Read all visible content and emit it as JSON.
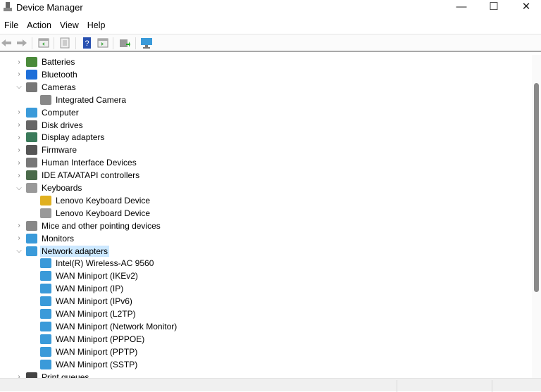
{
  "window": {
    "title": "Device Manager",
    "minimize": "—",
    "maximize": "☐",
    "close": "✕"
  },
  "menu": [
    "File",
    "Action",
    "View",
    "Help"
  ],
  "toolbar": [
    "back-icon",
    "forward-icon",
    "show-hide-console-tree-icon",
    "properties-icon",
    "help-icon",
    "action-pane-icon",
    "update-driver-icon",
    "scan-hardware-icon"
  ],
  "tree": [
    {
      "label": "Batteries",
      "level": 0,
      "state": "collapsed",
      "icon": "battery-icon",
      "color": "#4a8a3a"
    },
    {
      "label": "Bluetooth",
      "level": 0,
      "state": "collapsed",
      "icon": "bluetooth-icon",
      "color": "#1e6fd9"
    },
    {
      "label": "Cameras",
      "level": 0,
      "state": "expanded",
      "icon": "camera-icon",
      "color": "#777777"
    },
    {
      "label": "Integrated Camera",
      "level": 1,
      "icon": "camera-icon",
      "color": "#888888"
    },
    {
      "label": "Computer",
      "level": 0,
      "state": "collapsed",
      "icon": "computer-icon",
      "color": "#3a9ad9"
    },
    {
      "label": "Disk drives",
      "level": 0,
      "state": "collapsed",
      "icon": "disk-drive-icon",
      "color": "#666666"
    },
    {
      "label": "Display adapters",
      "level": 0,
      "state": "collapsed",
      "icon": "display-adapter-icon",
      "color": "#3a7a5a"
    },
    {
      "label": "Firmware",
      "level": 0,
      "state": "collapsed",
      "icon": "firmware-icon",
      "color": "#555555"
    },
    {
      "label": "Human Interface Devices",
      "level": 0,
      "state": "collapsed",
      "icon": "hid-icon",
      "color": "#777777"
    },
    {
      "label": "IDE ATA/ATAPI controllers",
      "level": 0,
      "state": "collapsed",
      "icon": "ide-controller-icon",
      "color": "#4a6a4a"
    },
    {
      "label": "Keyboards",
      "level": 0,
      "state": "expanded",
      "icon": "keyboard-icon",
      "color": "#999999"
    },
    {
      "label": "Lenovo Keyboard Device",
      "level": 1,
      "icon": "keyboard-warning-icon",
      "color": "#e0b020"
    },
    {
      "label": "Lenovo Keyboard Device",
      "level": 1,
      "icon": "keyboard-icon",
      "color": "#999999"
    },
    {
      "label": "Mice and other pointing devices",
      "level": 0,
      "state": "collapsed",
      "icon": "mouse-icon",
      "color": "#888888"
    },
    {
      "label": "Monitors",
      "level": 0,
      "state": "collapsed",
      "icon": "monitor-icon",
      "color": "#3a9ad9"
    },
    {
      "label": "Network adapters",
      "level": 0,
      "state": "expanded",
      "selected": true,
      "icon": "network-adapter-icon",
      "color": "#3a9ad9"
    },
    {
      "label": "Intel(R) Wireless-AC 9560",
      "level": 1,
      "icon": "network-adapter-icon",
      "color": "#3a9ad9"
    },
    {
      "label": "WAN Miniport (IKEv2)",
      "level": 1,
      "icon": "network-adapter-icon",
      "color": "#3a9ad9"
    },
    {
      "label": "WAN Miniport (IP)",
      "level": 1,
      "icon": "network-adapter-icon",
      "color": "#3a9ad9"
    },
    {
      "label": "WAN Miniport (IPv6)",
      "level": 1,
      "icon": "network-adapter-icon",
      "color": "#3a9ad9"
    },
    {
      "label": "WAN Miniport (L2TP)",
      "level": 1,
      "icon": "network-adapter-icon",
      "color": "#3a9ad9"
    },
    {
      "label": "WAN Miniport (Network Monitor)",
      "level": 1,
      "icon": "network-adapter-icon",
      "color": "#3a9ad9"
    },
    {
      "label": "WAN Miniport (PPPOE)",
      "level": 1,
      "icon": "network-adapter-icon",
      "color": "#3a9ad9"
    },
    {
      "label": "WAN Miniport (PPTP)",
      "level": 1,
      "icon": "network-adapter-icon",
      "color": "#3a9ad9"
    },
    {
      "label": "WAN Miniport (SSTP)",
      "level": 1,
      "icon": "network-adapter-icon",
      "color": "#3a9ad9"
    },
    {
      "label": "Print queues",
      "level": 0,
      "state": "collapsed",
      "icon": "printer-icon",
      "color": "#444444"
    }
  ]
}
